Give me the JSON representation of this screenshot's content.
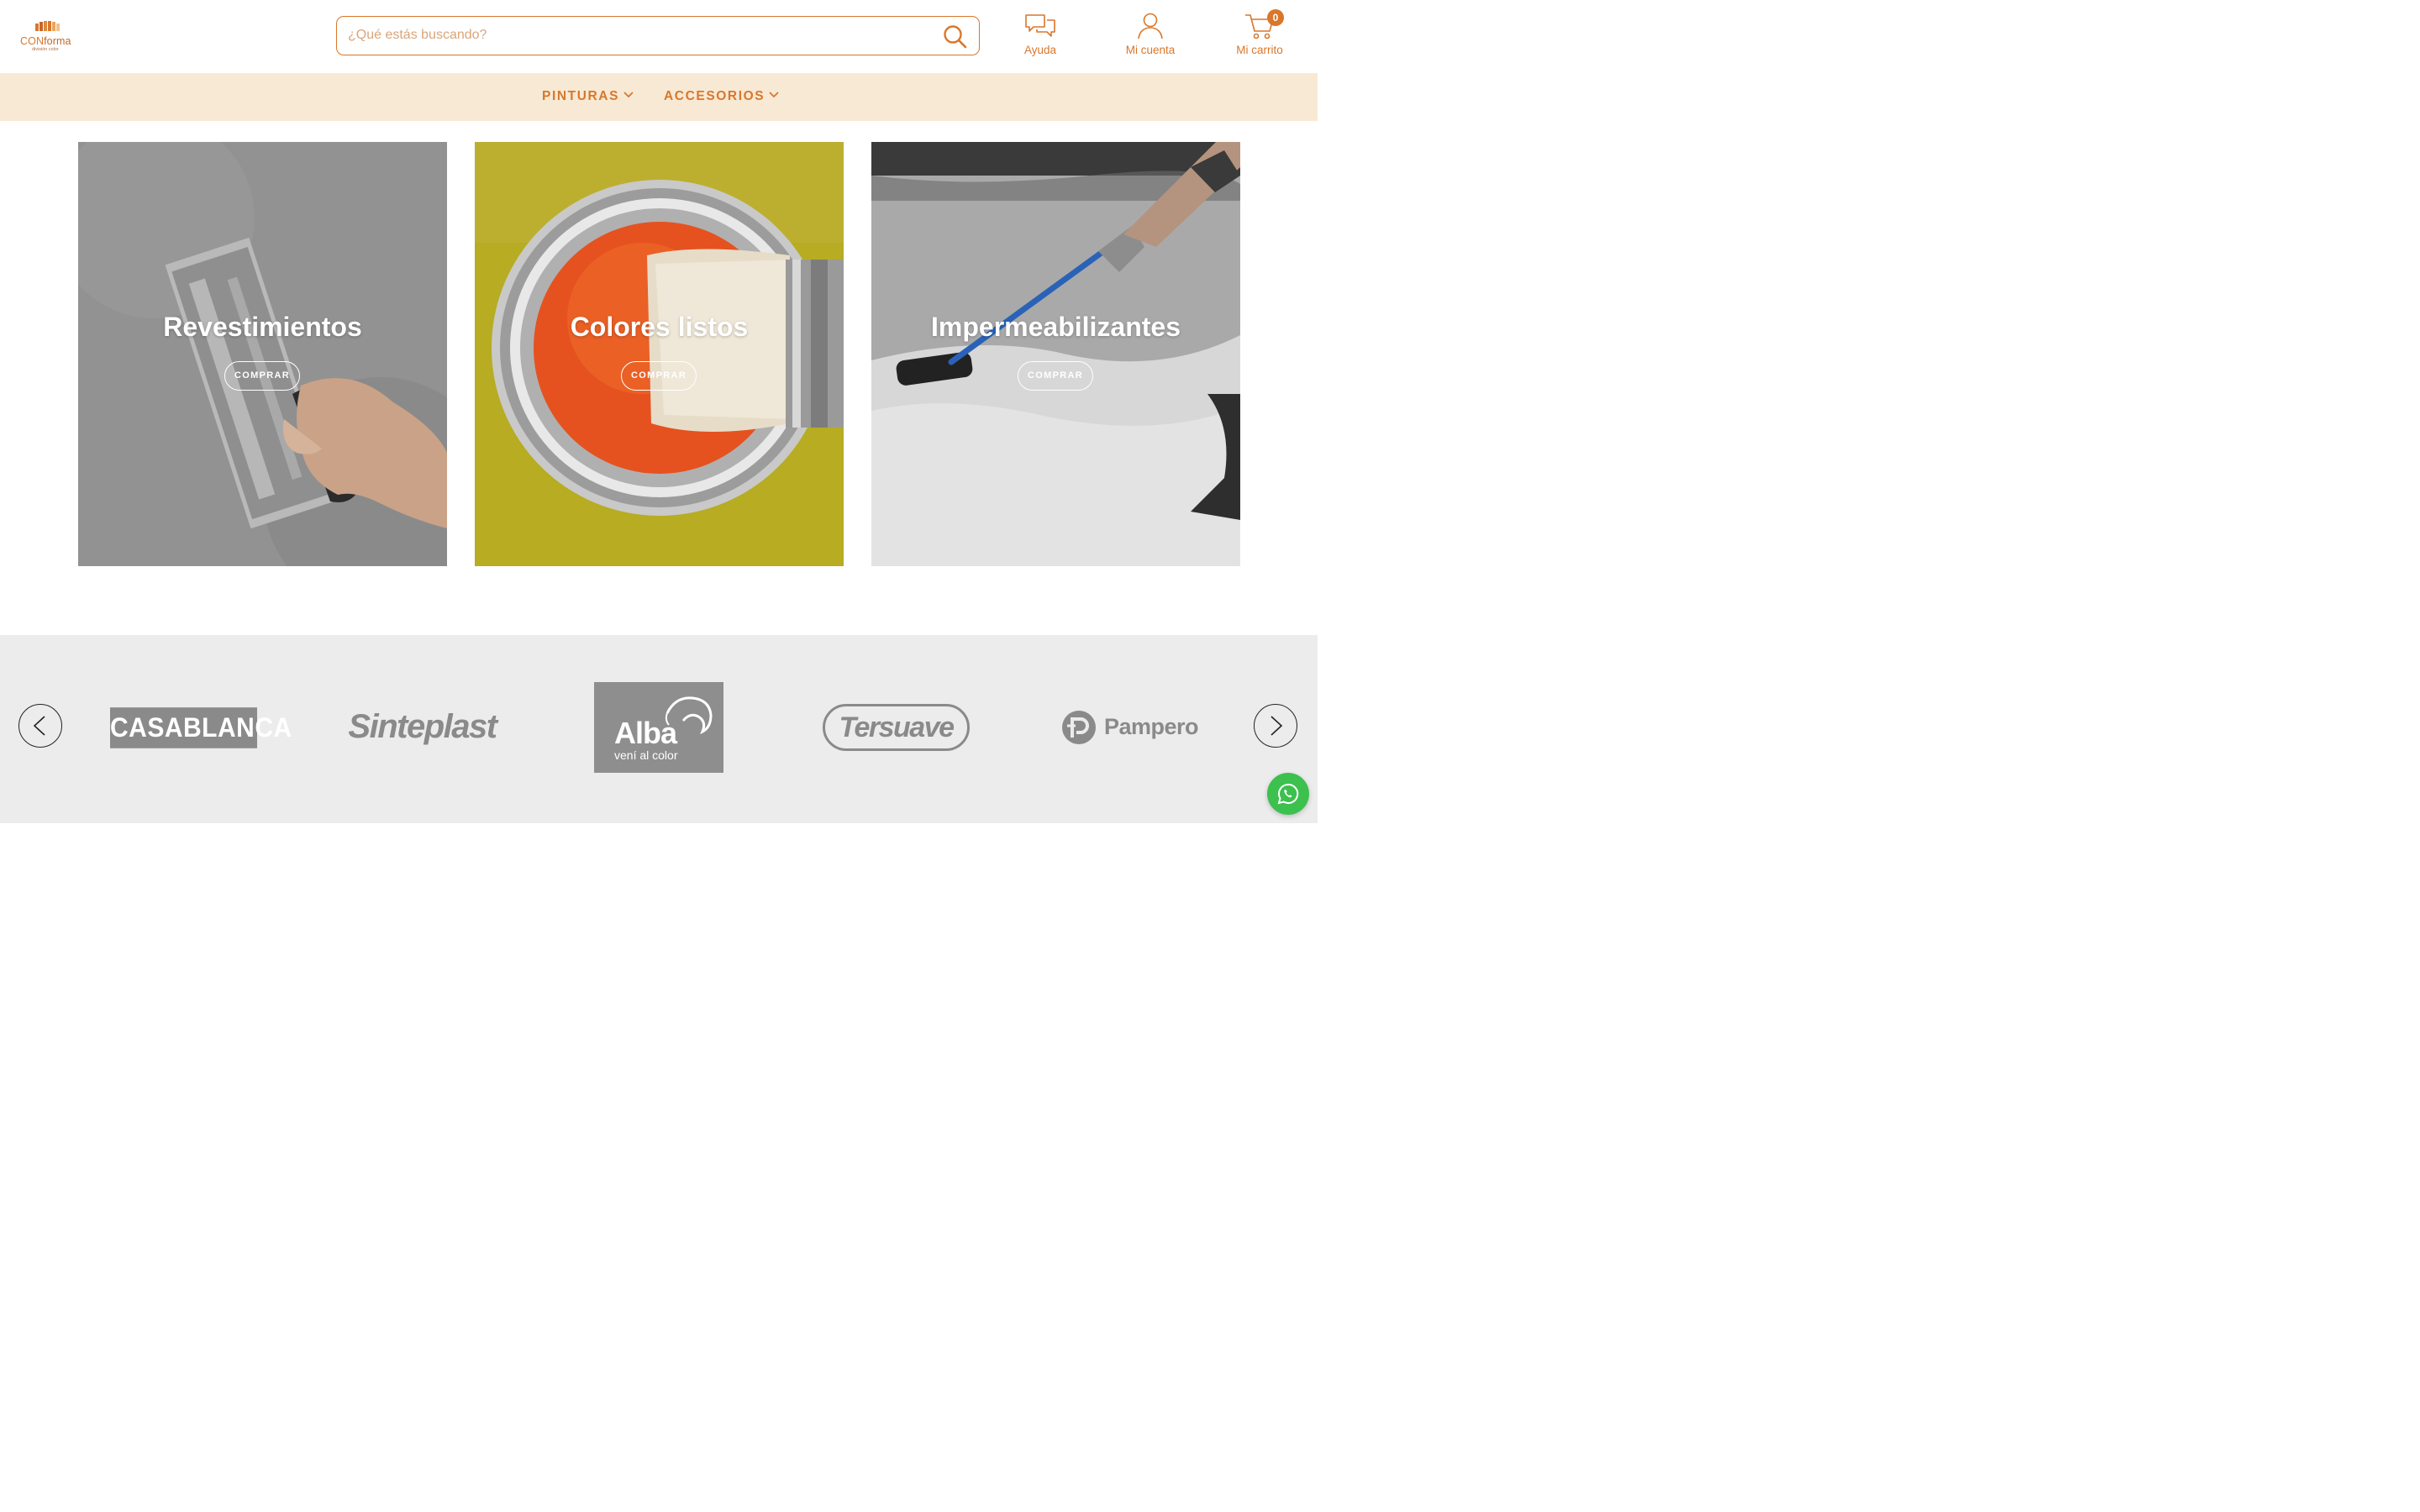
{
  "brand": {
    "logo_prefix": "CON",
    "logo_suffix": "forma",
    "logo_sub": "división color"
  },
  "search": {
    "placeholder": "¿Qué estás buscando?",
    "value": ""
  },
  "header_actions": {
    "help": "Ayuda",
    "account": "Mi cuenta",
    "cart": "Mi carrito",
    "cart_count": "0"
  },
  "nav": {
    "items": [
      {
        "label": "PINTURAS"
      },
      {
        "label": "ACCESORIOS"
      }
    ]
  },
  "categories": [
    {
      "title": "Revestimientos",
      "button": "COMPRAR"
    },
    {
      "title": "Colores listos",
      "button": "COMPRAR"
    },
    {
      "title": "Impermeabilizantes",
      "button": "COMPRAR"
    }
  ],
  "brands": {
    "items": [
      {
        "name": "CASABLANCA"
      },
      {
        "name": "Sinteplast"
      },
      {
        "name": "Alba",
        "tagline": "vení al color"
      },
      {
        "name": "Tersuave"
      },
      {
        "name": "Pampero"
      }
    ]
  },
  "colors": {
    "accent": "#d9772b",
    "nav_bg": "#f8e9d4",
    "brands_bg": "#ececec",
    "whatsapp": "#3cc04e"
  },
  "icons": [
    "search-icon",
    "chat-bubbles-icon",
    "user-icon",
    "cart-icon",
    "chevron-down-icon",
    "chevron-left-icon",
    "chevron-right-icon",
    "whatsapp-icon"
  ]
}
